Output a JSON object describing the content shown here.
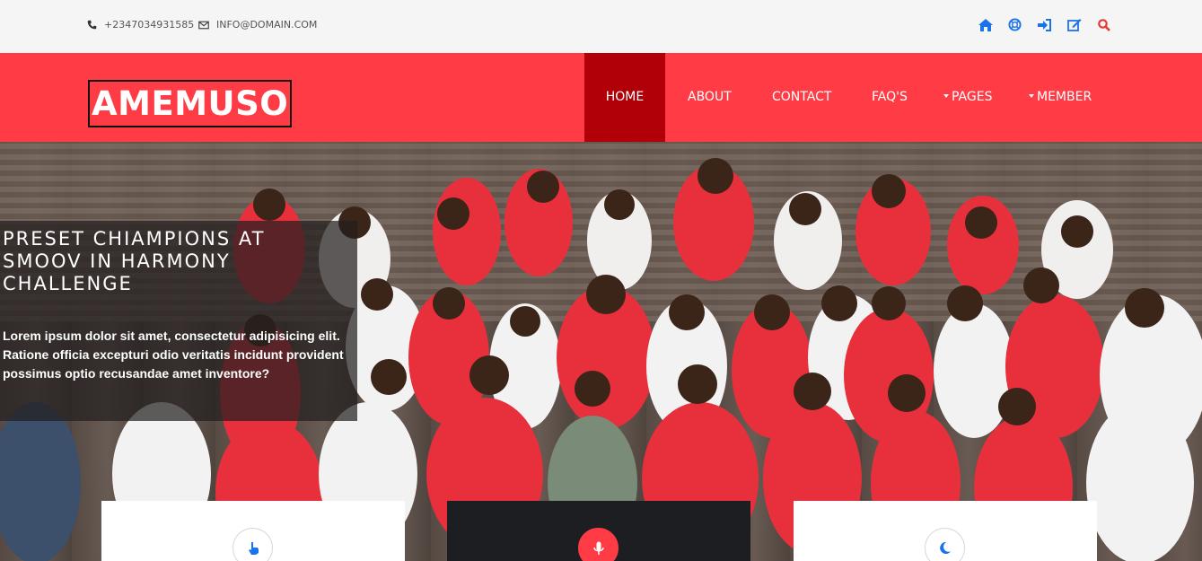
{
  "topbar": {
    "phone": "+2347034931585",
    "email": "INFO@DOMAIN.COM",
    "icons": [
      "home-icon",
      "lifebuoy-icon",
      "sign-in-icon",
      "edit-icon",
      "search-icon"
    ]
  },
  "brand": {
    "logo": "AMEMUSO"
  },
  "nav": {
    "home": "HOME",
    "about": "ABOUT",
    "contact": "CONTACT",
    "faqs": "FAQ'S",
    "pages": "PAGES",
    "member": "MEMBER"
  },
  "hero": {
    "title": "PRESET CHIAMPIONS AT SMOOV IN HARMONY CHALLENGE",
    "text": "Lorem ipsum dolor sit amet, consectetur adipisicing elit. Ratione officia excepturi odio veritatis incidunt provident possimus optio recusandae amet inventore?"
  },
  "cards": [
    {
      "icon": "hand-pointer-icon"
    },
    {
      "icon": "microphone-icon"
    },
    {
      "icon": "moon-icon"
    }
  ],
  "colors": {
    "accent": "#ff3b46",
    "active": "#b10008",
    "icon_blue": "#1a73e8",
    "icon_red": "#e53935",
    "dark_card": "#1d1e22"
  }
}
